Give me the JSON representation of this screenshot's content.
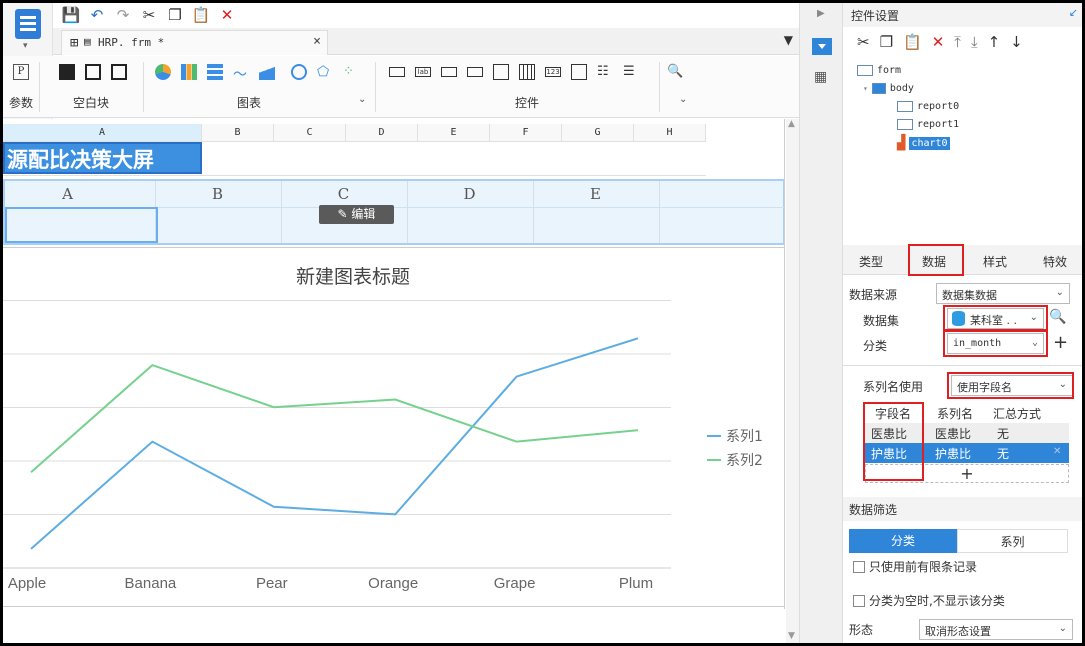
{
  "toolbar": {
    "quick_icons": [
      "save-icon",
      "undo-icon",
      "redo-icon",
      "cut-icon",
      "copy-icon",
      "paste-icon",
      "delete-icon"
    ]
  },
  "tab": {
    "title": "HRP. frm *",
    "close": "×"
  },
  "ribbon": {
    "groups": [
      {
        "label": "参数"
      },
      {
        "label": "空白块"
      },
      {
        "label": "图表"
      },
      {
        "label": "控件"
      }
    ]
  },
  "sheet": {
    "columns_top": [
      "A",
      "B",
      "C",
      "D",
      "E",
      "F",
      "G",
      "H"
    ],
    "title_text": "源配比决策大屏",
    "report_columns": [
      "A",
      "B",
      "C",
      "D",
      "E"
    ],
    "edit_button": "编辑"
  },
  "chart_data": {
    "type": "line",
    "title": "新建图表标题",
    "categories": [
      "Apple",
      "Banana",
      "Pear",
      "Orange",
      "Grape",
      "Plum"
    ],
    "series": [
      {
        "name": "系列1",
        "color": "#5dade2",
        "values": [
          0.5,
          3.3,
          1.6,
          1.4,
          5.0,
          6.0
        ]
      },
      {
        "name": "系列2",
        "color": "#76d18f",
        "values": [
          2.5,
          5.3,
          4.2,
          4.4,
          3.3,
          3.6
        ]
      }
    ],
    "ylim": [
      0,
      7
    ],
    "grid": true,
    "legend": "right"
  },
  "panel": {
    "header": "控件设置",
    "tree": [
      {
        "label": "form"
      },
      {
        "label": "body"
      },
      {
        "label": "report0"
      },
      {
        "label": "report1"
      },
      {
        "label": "chart0"
      }
    ],
    "tabs": [
      "类型",
      "数据",
      "样式",
      "特效"
    ],
    "data_source_label": "数据来源",
    "data_source_value": "数据集数据",
    "dataset_label": "数据集",
    "dataset_value": "某科室 . .",
    "category_label": "分类",
    "category_value": "in_month",
    "series_name_label": "系列名使用",
    "series_name_value": "使用字段名",
    "table_headers": [
      "字段名",
      "系列名",
      "汇总方式"
    ],
    "rows": [
      {
        "field": "医患比",
        "series": "医患比",
        "summary": "无"
      },
      {
        "field": "护患比",
        "series": "护患比",
        "summary": "无"
      }
    ],
    "add": "+",
    "filter_section": "数据筛选",
    "seg_left": "分类",
    "seg_right": "系列",
    "chk1": "只使用前有限条记录",
    "chk2": "分类为空时,不显示该分类",
    "form_label": "形态",
    "form_value": "取消形态设置"
  }
}
